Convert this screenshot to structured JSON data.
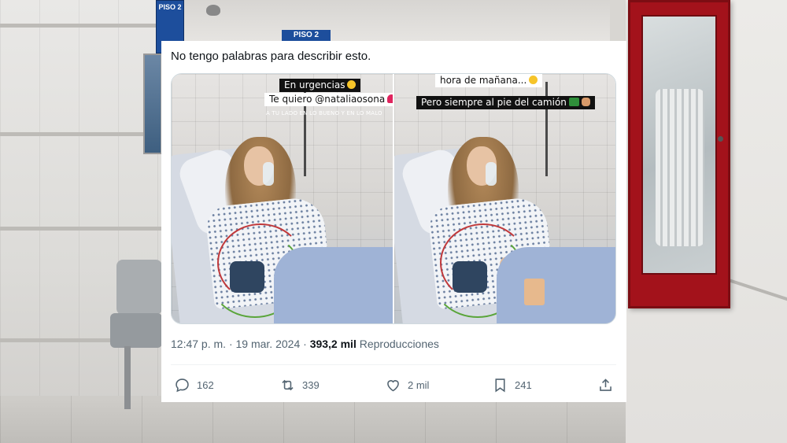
{
  "background": {
    "sign_floor_top": "PISO 2",
    "sign_floor_ceiling": "PISO 2"
  },
  "tweet": {
    "text": "No tengo palabras para describir esto.",
    "media": {
      "left": {
        "caption_1": "En urgencias",
        "caption_2": "Te quiero @nataliaosona",
        "caption_3": "A TU LADO EN LO BUENO Y EN LO MALO"
      },
      "right": {
        "caption_1": "hora de mañana...",
        "caption_2a": "Pero siempre al pie",
        "caption_2b": "del camión"
      }
    },
    "time": "12:47 p. m.",
    "date": "19 mar. 2024",
    "views": "393,2 mil",
    "views_label": "Reproducciones",
    "actions": {
      "replies": "162",
      "reposts": "339",
      "likes": "2 mil",
      "bookmarks": "241"
    }
  },
  "colors": {
    "text_primary": "#0f1419",
    "text_secondary": "#536471",
    "fire_cabinet": "#a3121b",
    "sign_blue": "#1d4e9c"
  }
}
